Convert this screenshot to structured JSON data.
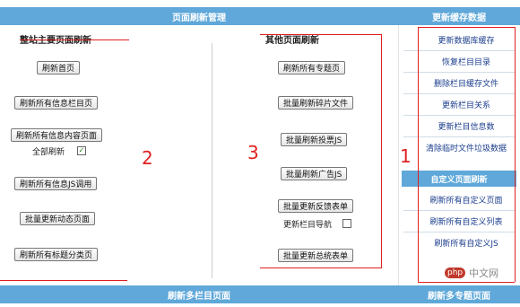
{
  "header": {
    "title": "页面刷新管理",
    "right_title": "更新缓存数据"
  },
  "left_column": {
    "title": "整站主要页面刷新",
    "buttons": [
      "刷新首页",
      "刷新所有信息栏目页",
      "刷新所有信息内容页面",
      "刷新所有信息JS调用",
      "批量更新动态页面",
      "刷新所有标题分类页"
    ],
    "checkbox_label": "全部刷新",
    "checkbox_checked": true
  },
  "middle_column": {
    "title": "其他页面刷新",
    "buttons": [
      "刷新所有专题页",
      "批量刷新碎片文件",
      "批量刷新投票JS",
      "批量刷新广告JS",
      "批量更新反馈表单",
      "批量更新总统表单"
    ],
    "checkbox_label": "更新栏目导航",
    "checkbox_checked": false
  },
  "sidebar": {
    "items": [
      "更新数据库缓存",
      "恢复栏目目录",
      "删除栏目缓存文件",
      "更新栏目关系",
      "更新栏目信息数",
      "清除临时文件垃圾数据"
    ],
    "subheader": "自定义页面刷新",
    "custom_items": [
      "刷新所有自定义页面",
      "刷新所有自定义列表",
      "刷新所有自定义JS"
    ]
  },
  "footer": {
    "left_title": "刷新多栏目页面",
    "right_title": "刷新多专题页面"
  },
  "annotations": {
    "num1": "1",
    "num2": "2",
    "num3": "3"
  },
  "watermark": {
    "logo": "php",
    "text": "中文网"
  },
  "colors": {
    "bar": "#5fa8d9",
    "annotation": "#e02020",
    "link": "#1a3d8c"
  }
}
